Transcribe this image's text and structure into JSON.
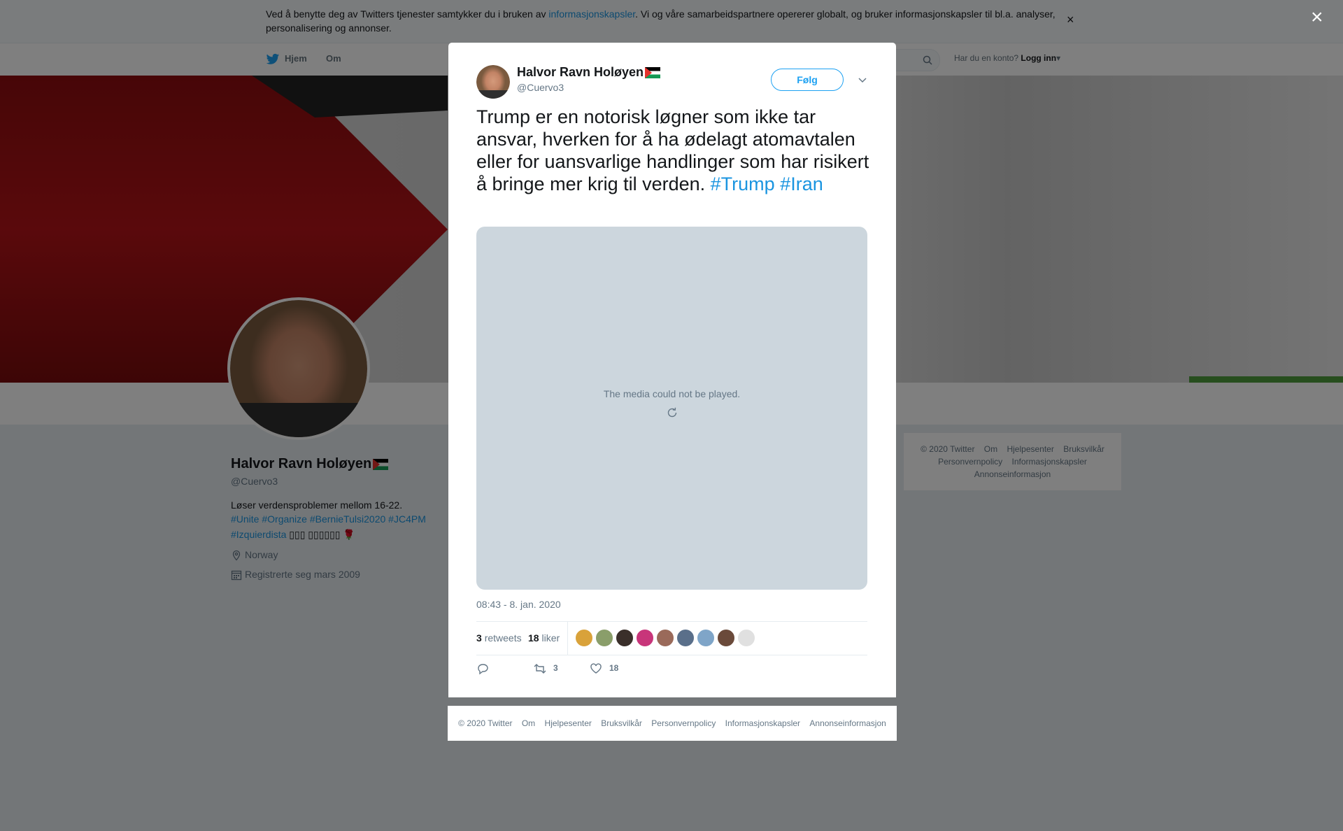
{
  "cookie": {
    "text_before": "Ved å benytte deg av Twitters tjenester samtykker du i bruken av ",
    "link": "informasjonskapsler",
    "text_after": ". Vi og våre samarbeidspartnere opererer globalt, og bruker informasjonskapsler til bl.a. analyser, personalisering og annonser.",
    "close": "×"
  },
  "nav": {
    "home": "Hjem",
    "about": "Om",
    "login_prompt": "Har du en konto?",
    "login": "Logg inn"
  },
  "profile": {
    "name": "Halvor Ravn Holøyen",
    "handle": "@Cuervo3",
    "bio": "Løser verdensproblemer mellom 16-22.",
    "bio_tags": "#Unite #Organize #BernieTulsi2020 #JC4PM",
    "bio_tags2": "#Izquierdista",
    "bio_tail": "▯▯▯ ▯▯▯▯▯▯ 🌹",
    "location": "Norway",
    "joined": "Registrerte seg mars 2009"
  },
  "right_footer": {
    "items": [
      "© 2020 Twitter",
      "Om",
      "Hjelpesenter",
      "Bruksvilkår",
      "Personvernpolicy",
      "Informasjonskapsler",
      "Annonseinformasjon"
    ]
  },
  "overlay": {
    "close": "×"
  },
  "tweet": {
    "name": "Halvor Ravn Holøyen",
    "handle": "@Cuervo3",
    "follow": "Følg",
    "text": "Trump er en notorisk løgner som ikke tar ansvar, hverken for å ha ødelagt atomavtalen eller for uansvarlige handlinger som har risikert å bringe mer krig til verden. ",
    "hashtag1": "#Trump",
    "hashtag2": "#Iran",
    "media_message": "The media could not be played.",
    "timestamp": "08:43 - 8. jan. 2020",
    "retweets_count": "3",
    "retweets_label": "retweets",
    "likes_count": "18",
    "likes_label": "liker",
    "action_retweets": "3",
    "action_likes": "18"
  },
  "liker_colors": [
    "#d9a23a",
    "#8a9e6a",
    "#3a2f2a",
    "#c8357a",
    "#9a6a5a",
    "#5a6f8a",
    "#7fa5c8",
    "#6a4a3a",
    "#e0e0e0"
  ],
  "modal_footer": {
    "items": [
      "© 2020 Twitter",
      "Om",
      "Hjelpesenter",
      "Bruksvilkår",
      "Personvernpolicy",
      "Informasjonskapsler",
      "Annonseinformasjon"
    ]
  }
}
